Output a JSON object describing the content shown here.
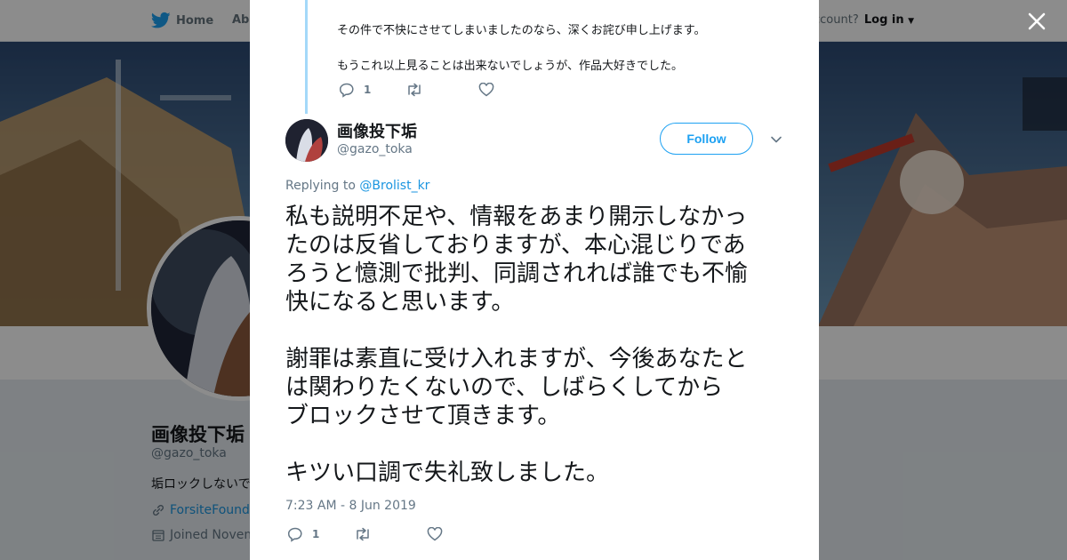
{
  "nav": {
    "home_label": "Home",
    "about_label": "Abo",
    "account_prompt": "ccount?",
    "login_label": "Log in"
  },
  "profile": {
    "name": "画像投下垢",
    "handle": "@gazo_toka",
    "bio": "垢ロックしないで",
    "link_text": "ForsiteFounda",
    "joined_text": "Joined Novem"
  },
  "previous_tweet": {
    "lines": [
      "その件で不快にさせてしまいましたのなら、深くお詫び申し上げます。",
      "もうこれ以上見ることは出来ないでしょうが、作品大好きでした。"
    ],
    "reply_count": "1"
  },
  "tweet": {
    "author_name": "画像投下垢",
    "author_handle": "@gazo_toka",
    "follow_label": "Follow",
    "replying_prefix": "Replying to",
    "replying_mention": "@Brolist_kr",
    "text_lines": [
      "私も説明不足や、情報をあまり開示しなかっ",
      "たのは反省しておりますが、本心混じりであ",
      "ろうと憶測で批判、同調されれば誰でも不愉",
      "快になると思います。",
      "",
      "謝罪は素直に受け入れますが、今後あなたと",
      "は関わりたくないので、しばらくしてから",
      "ブロックさせて頂きます。",
      "",
      "キツい口調で失礼致しました。"
    ],
    "timestamp": "7:23 AM - 8 Jun 2019",
    "reply_count": "1"
  },
  "icons": {
    "brand": "twitter-bird-icon",
    "close": "close-icon",
    "reply": "reply-icon",
    "retweet": "retweet-icon",
    "like": "heart-icon",
    "more": "chevron-down-icon",
    "link": "link-icon",
    "calendar": "calendar-icon"
  },
  "colors": {
    "accent": "#1da1f2",
    "link": "#1b95e0",
    "thread_line": "#a4d9f9",
    "secondary_text": "#657786"
  }
}
